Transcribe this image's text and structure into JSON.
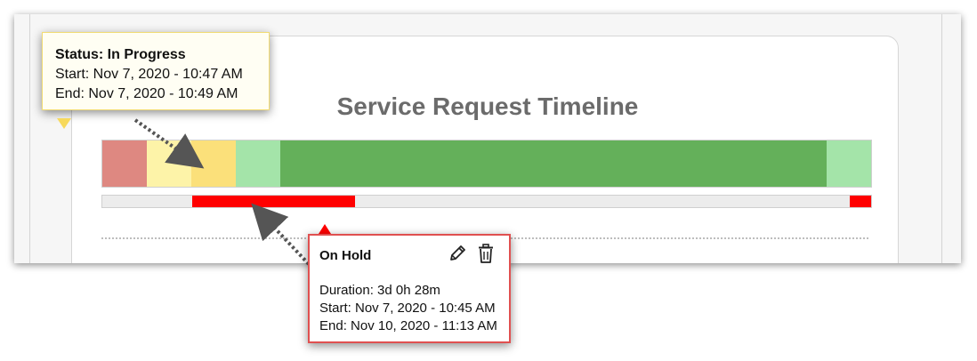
{
  "page": {
    "title": "Service Request Timeline"
  },
  "status_bar": {
    "segments": [
      {
        "status": "red",
        "color": "#de8881",
        "share": 0.058
      },
      {
        "status": "light-yellow",
        "color": "#fdf3a8",
        "share": 0.058
      },
      {
        "status": "yellow",
        "color": "#fbe07a",
        "share": 0.058
      },
      {
        "status": "light-green",
        "color": "#a4e4a9",
        "share": 0.057
      },
      {
        "status": "green",
        "color": "#64b05a",
        "share": 0.711
      },
      {
        "status": "light-green",
        "color": "#a4e4a9",
        "share": 0.058
      }
    ]
  },
  "hold_track": {
    "holds": [
      {
        "start_fraction": 0.117,
        "end_fraction": 0.329
      },
      {
        "start_fraction": 0.972,
        "end_fraction": 1.0
      }
    ]
  },
  "tooltip_status": {
    "title": "Status: In Progress",
    "start": "Start: Nov 7, 2020 - 10:47 AM",
    "end": "End: Nov 7, 2020 - 10:49 AM"
  },
  "tooltip_hold": {
    "title": "On Hold",
    "duration": "Duration: 3d 0h 28m",
    "start": "Start: Nov 7, 2020 - 10:45 AM",
    "end": "End: Nov 10, 2020 - 11:13 AM",
    "icons": [
      "pencil-icon",
      "trash-icon"
    ]
  },
  "colors": {
    "hold": "#ff0000",
    "tooltip_status_border": "#f2dc74",
    "tooltip_hold_border": "#e05050",
    "title_text": "#6b6b6b"
  }
}
